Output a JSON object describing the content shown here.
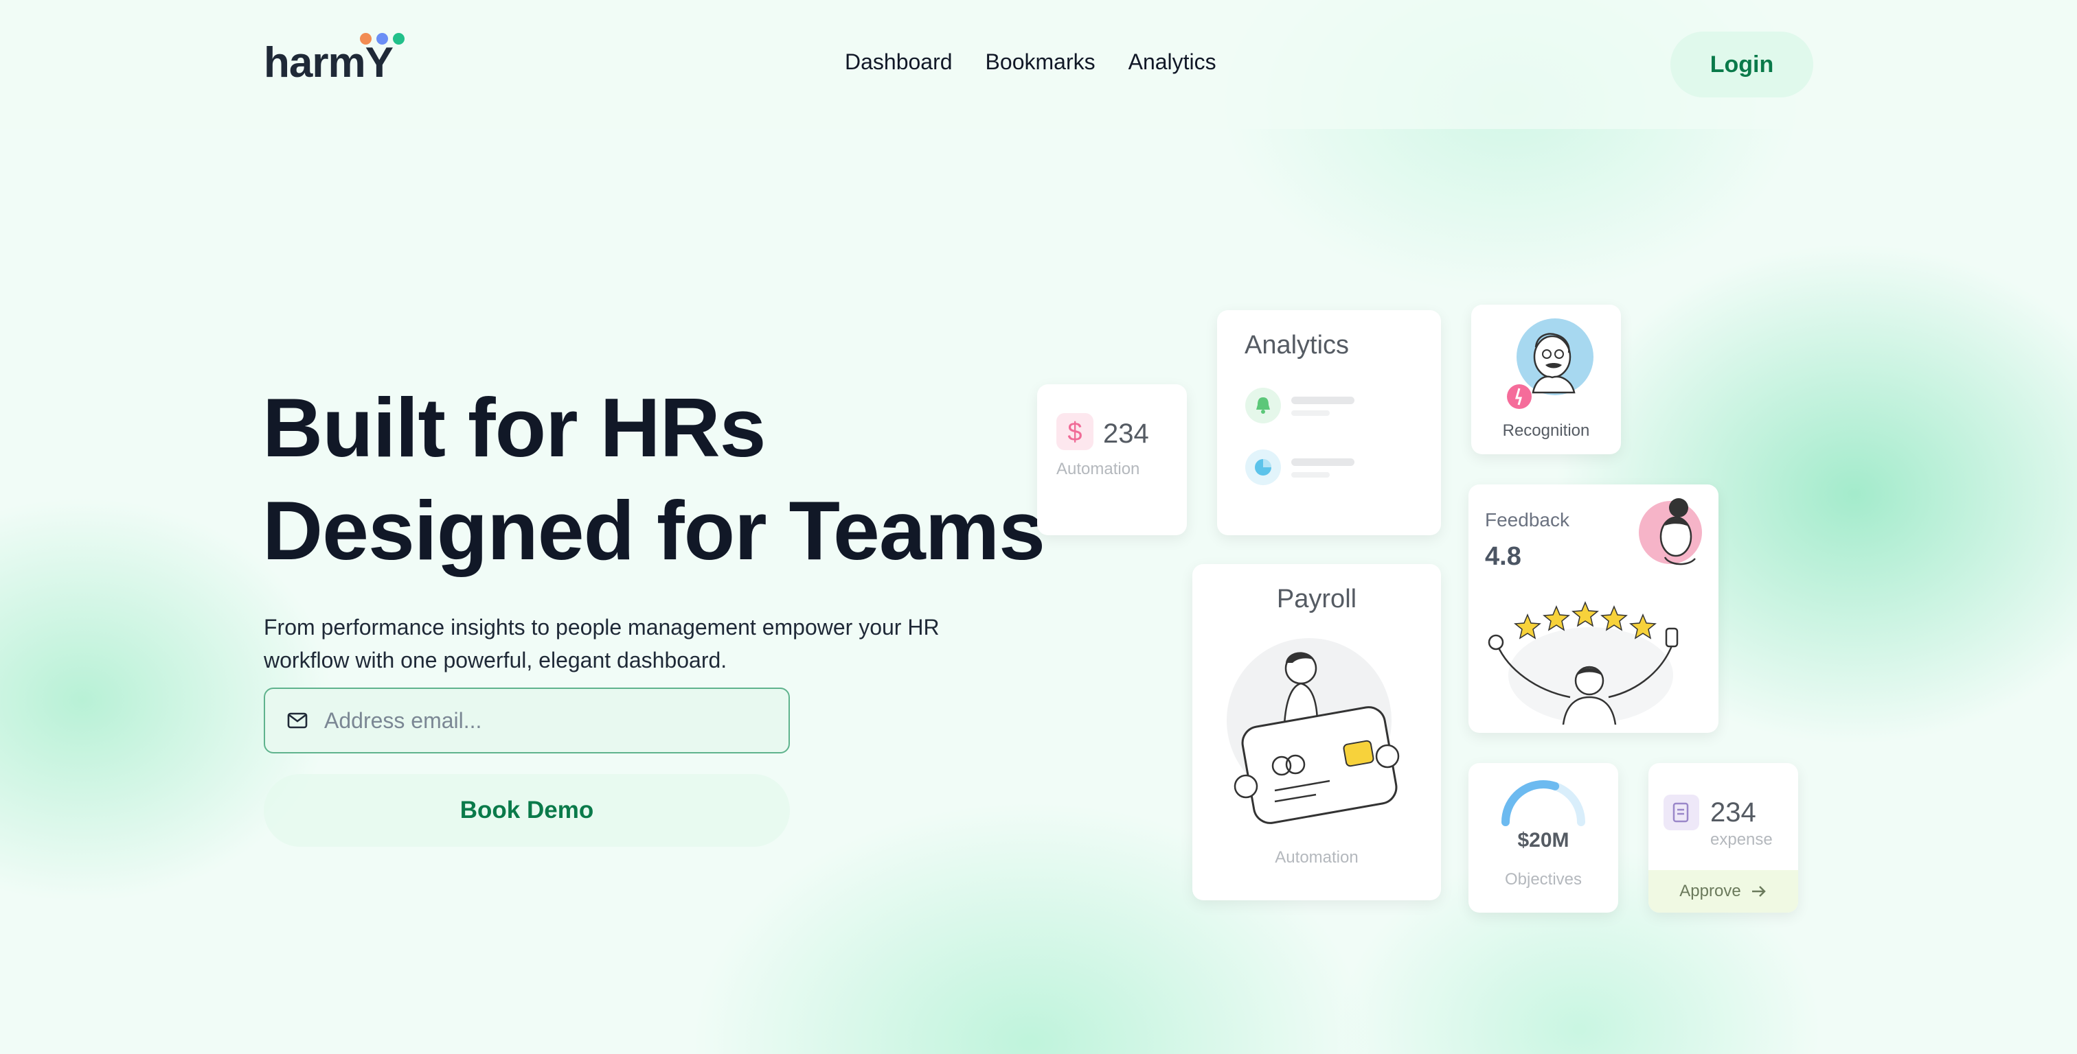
{
  "brand": {
    "name": "harmY",
    "dot_colors": [
      "#f28c53",
      "#6b8ef5",
      "#22c08a"
    ]
  },
  "nav": {
    "links": [
      "Dashboard",
      "Bookmarks",
      "Analytics"
    ],
    "login_label": "Login"
  },
  "hero": {
    "title_line1": "Built for HRs",
    "title_line2": "Designed for Teams",
    "subtitle": "From performance insights to people management empower your HR workflow with one powerful, elegant dashboard.",
    "email_placeholder": "Address email...",
    "cta_label": "Book Demo"
  },
  "cards": {
    "automation": {
      "value": "234",
      "label": "Automation",
      "icon": "dollar-icon"
    },
    "analytics": {
      "title": "Analytics",
      "icons": [
        "bell-icon",
        "pie-chart-icon"
      ]
    },
    "recognition": {
      "label": "Recognition"
    },
    "payroll": {
      "title": "Payroll",
      "label": "Automation"
    },
    "feedback": {
      "title": "Feedback",
      "score": "4.8"
    },
    "objectives": {
      "value": "$20M",
      "label": "Objectives",
      "progress": 0.6
    },
    "expense": {
      "value": "234",
      "label": "expense",
      "action_label": "Approve",
      "icon": "receipt-icon"
    }
  },
  "colors": {
    "accent_green": "#0a7a4a",
    "heading": "#111827",
    "email_border": "#5fb38d"
  }
}
